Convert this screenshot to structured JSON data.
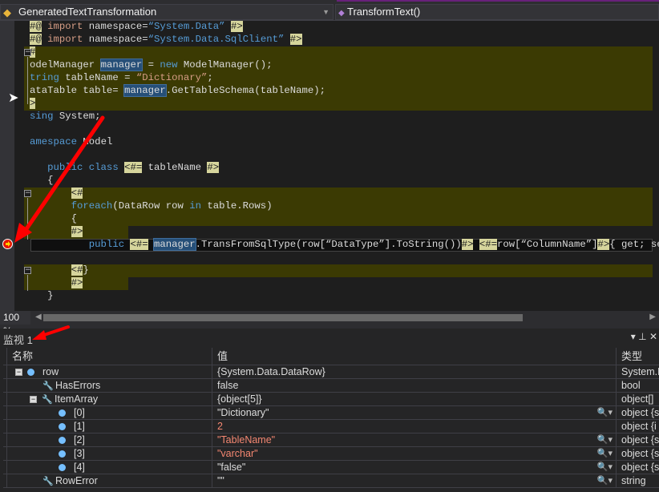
{
  "navbar": {
    "left_combo": "GeneratedTextTransformation",
    "right_combo": "TransformText()"
  },
  "code_lines": [
    {
      "segs": [
        [
          "tag",
          "#@"
        ],
        [
          "str",
          " import"
        ],
        [
          "",
          " namespace="
        ],
        [
          "kw",
          "“System.Data”"
        ],
        [
          "",
          " "
        ],
        [
          "tag",
          "#>"
        ]
      ]
    },
    {
      "segs": [
        [
          "tag",
          "#@"
        ],
        [
          "str",
          " import"
        ],
        [
          "",
          " namespace="
        ],
        [
          "kw",
          "“System.Data.SqlClient”"
        ],
        [
          "",
          " "
        ],
        [
          "tag",
          "#>"
        ]
      ]
    },
    {
      "segs": [
        [
          "tag",
          "#"
        ]
      ]
    },
    {
      "segs": [
        [
          "",
          "odelManager "
        ],
        [
          "hl",
          "manager"
        ],
        [
          "",
          " = "
        ],
        [
          "kw",
          "new"
        ],
        [
          "",
          " ModelManager();"
        ]
      ]
    },
    {
      "segs": [
        [
          "kw",
          "tring"
        ],
        [
          "",
          " tableName = "
        ],
        [
          "str",
          "“Dictionary”"
        ],
        [
          "",
          ";"
        ]
      ]
    },
    {
      "segs": [
        [
          "",
          "ataTable table= "
        ],
        [
          "hl",
          "manager"
        ],
        [
          "",
          ".GetTableSchema(tableName);"
        ]
      ]
    },
    {
      "segs": [
        [
          "tag",
          ">"
        ]
      ]
    },
    {
      "segs": [
        [
          "kw",
          "sing"
        ],
        [
          "",
          " System;"
        ]
      ]
    },
    {
      "segs": []
    },
    {
      "segs": [
        [
          "kw",
          "amespace"
        ],
        [
          "",
          " Model"
        ]
      ]
    },
    {
      "segs": []
    },
    {
      "segs": [
        [
          "",
          "   "
        ],
        [
          "kw",
          "public class "
        ],
        [
          "tag",
          "<#="
        ],
        [
          "",
          " tableName "
        ],
        [
          "tag",
          "#>"
        ]
      ]
    },
    {
      "segs": [
        [
          "",
          "   {"
        ]
      ]
    },
    {
      "segs": [
        [
          "",
          "       "
        ],
        [
          "tag",
          "<#"
        ]
      ]
    },
    {
      "segs": [
        [
          "",
          "       "
        ],
        [
          "kw",
          "foreach"
        ],
        [
          "",
          "(DataRow row "
        ],
        [
          "kw",
          "in"
        ],
        [
          "",
          " table.Rows)"
        ]
      ]
    },
    {
      "segs": [
        [
          "",
          "       {"
        ]
      ]
    },
    {
      "segs": [
        [
          "",
          "       "
        ],
        [
          "tag",
          "#>"
        ]
      ]
    },
    {
      "segs": [
        [
          "",
          "          "
        ],
        [
          "kw",
          "public "
        ],
        [
          "tag",
          "<#="
        ],
        [
          "",
          " "
        ],
        [
          "hl",
          "manager"
        ],
        [
          "",
          ".TransFromSqlType(row[“DataType”].ToString())"
        ],
        [
          "tag",
          "#>"
        ],
        [
          "",
          " "
        ],
        [
          "tag",
          "<#="
        ],
        [
          "",
          "row[“ColumnName”]"
        ],
        [
          "tag",
          "#>"
        ],
        [
          "",
          "{ get; set; }"
        ]
      ]
    },
    {
      "segs": []
    },
    {
      "segs": [
        [
          "",
          "       "
        ],
        [
          "tag",
          "<#"
        ],
        [
          "",
          "}"
        ]
      ]
    },
    {
      "segs": [
        [
          "",
          "       "
        ],
        [
          "tag",
          "#>"
        ]
      ]
    },
    {
      "segs": [
        [
          "",
          "   }"
        ]
      ]
    }
  ],
  "zoom_level": "100 %",
  "watch": {
    "title": "监视 1",
    "columns": [
      "名称",
      "值",
      "类型"
    ],
    "rows": [
      {
        "name": "row",
        "value": "{System.Data.DataRow}",
        "type": "System.D",
        "icon": "object",
        "expand": "minus",
        "indent": 0
      },
      {
        "name": "HasErrors",
        "value": "false",
        "type": "bool",
        "icon": "wrench",
        "indent": 1
      },
      {
        "name": "ItemArray",
        "value": "{object[5]}",
        "type": "object[]",
        "icon": "wrench",
        "expand": "minus",
        "indent": 1
      },
      {
        "name": "[0]",
        "value": "\"Dictionary\"",
        "type": "object {s",
        "icon": "object",
        "indent": 2,
        "mag": true
      },
      {
        "name": "[1]",
        "value": "2",
        "type": "object {i",
        "icon": "object",
        "indent": 2,
        "changed": true
      },
      {
        "name": "[2]",
        "value": "\"TableName\"",
        "type": "object {s",
        "icon": "object",
        "indent": 2,
        "mag": true,
        "changed": true
      },
      {
        "name": "[3]",
        "value": "\"varchar\"",
        "type": "object {s",
        "icon": "object",
        "indent": 2,
        "mag": true,
        "changed": true
      },
      {
        "name": "[4]",
        "value": "\"false\"",
        "type": "object {s",
        "icon": "object",
        "indent": 2,
        "mag": true
      },
      {
        "name": "RowError",
        "value": "\"\"",
        "type": "string",
        "icon": "wrench",
        "indent": 1,
        "mag": true
      }
    ]
  },
  "colors": {
    "accent": "#68217a",
    "annotation_arrow": "#ff0000",
    "template_block": "#3b3a03",
    "tag": "#d6d59c",
    "changed_value": "#f48771"
  }
}
